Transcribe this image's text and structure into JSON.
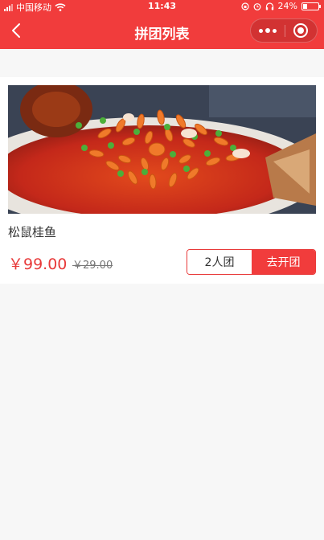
{
  "status_bar": {
    "carrier": "中国移动",
    "time": "11:43",
    "battery": "24%"
  },
  "nav": {
    "title": "拼团列表"
  },
  "product": {
    "name": "松鼠桂鱼",
    "price": "￥99.00",
    "original_price": "￥29.00",
    "group_size_label": "2人团",
    "action_label": "去开团"
  },
  "colors": {
    "brand_red": "#f13c3c",
    "price_red": "#e83a3a"
  }
}
